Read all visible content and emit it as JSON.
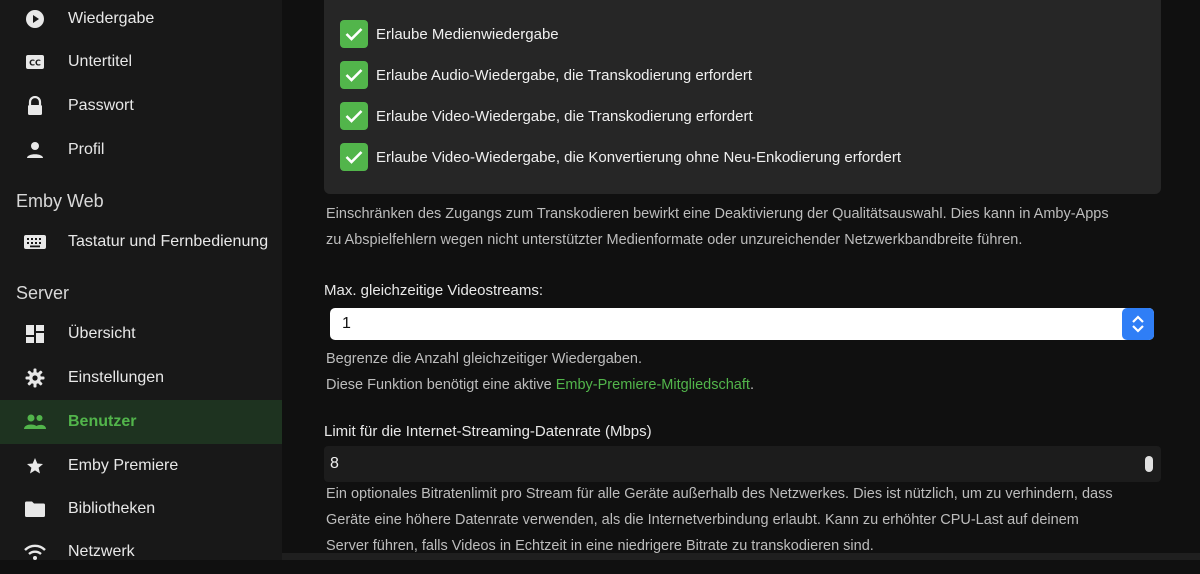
{
  "sidebar": {
    "items_top": [
      {
        "label": "Wiedergabe",
        "icon": "play-circle-icon"
      },
      {
        "label": "Untertitel",
        "icon": "cc-icon"
      },
      {
        "label": "Passwort",
        "icon": "lock-icon"
      },
      {
        "label": "Profil",
        "icon": "person-icon"
      }
    ],
    "section_web": "Emby Web",
    "items_web": [
      {
        "label": "Tastatur und Fernbedienung",
        "icon": "keyboard-icon"
      }
    ],
    "section_server": "Server",
    "items_server": [
      {
        "label": "Übersicht",
        "icon": "dashboard-icon"
      },
      {
        "label": "Einstellungen",
        "icon": "gear-icon"
      },
      {
        "label": "Benutzer",
        "icon": "people-icon",
        "active": true
      },
      {
        "label": "Emby Premiere",
        "icon": "star-icon"
      },
      {
        "label": "Bibliotheken",
        "icon": "folder-icon"
      },
      {
        "label": "Netzwerk",
        "icon": "wifi-icon"
      }
    ]
  },
  "checkboxes": [
    {
      "label": "Erlaube Medienwiedergabe",
      "checked": true
    },
    {
      "label": "Erlaube Audio-Wiedergabe, die Transkodierung erfordert",
      "checked": true
    },
    {
      "label": "Erlaube Video-Wiedergabe, die Transkodierung erfordert",
      "checked": true
    },
    {
      "label": "Erlaube Video-Wiedergabe, die Konvertierung ohne Neu-Enkodierung erfordert",
      "checked": true
    }
  ],
  "transcode_help_1": "Einschränken des Zugangs zum Transkodieren bewirkt eine Deaktivierung der Qualitätsauswahl. Dies kann in Amby-Apps",
  "transcode_help_2": "zu Abspielfehlern wegen nicht unterstützter Medienformate oder unzureichender Netzwerkbandbreite führen.",
  "streams": {
    "label": "Max. gleichzeitige Videostreams:",
    "value": "1",
    "help_1": "Begrenze die Anzahl gleichzeitiger Wiedergaben.",
    "help_2_prefix": "Diese Funktion benötigt eine aktive ",
    "help_2_link": "Emby-Premiere-Mitgliedschaft",
    "help_2_suffix": "."
  },
  "bitrate": {
    "label": "Limit für die Internet-Streaming-Datenrate (Mbps)",
    "value": "8",
    "help_1": "Ein optionales Bitratenlimit pro Stream für alle Geräte außerhalb des Netzwerkes. Dies ist nützlich, um zu verhindern, dass",
    "help_2": "Geräte eine höhere Datenrate verwenden, als die Internetverbindung erlaubt. Kann zu erhöhter CPU-Last auf deinem",
    "help_3": "Server führen, falls Videos in Echtzeit in eine niedrigere Bitrate zu transkodieren sind."
  },
  "colors": {
    "accent": "#52b54b",
    "select_button": "#2f7ef6"
  }
}
